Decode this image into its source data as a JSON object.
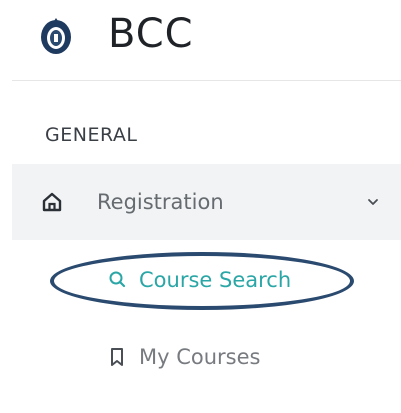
{
  "app": {
    "title": "BCC"
  },
  "sidebar": {
    "section_label": "GENERAL",
    "nav": {
      "label": "Registration",
      "icon": "home-icon",
      "expanded": true,
      "children": [
        {
          "label": "Course Search",
          "icon": "search-icon",
          "active": true
        },
        {
          "label": "My Courses",
          "icon": "bookmark-icon",
          "active": false
        }
      ]
    }
  },
  "colors": {
    "accent": "#2aa6a6",
    "nav_background": "#f2f3f5",
    "highlight_outline": "#2b4a6f",
    "text_primary": "#1f2328",
    "text_muted": "#666b70"
  }
}
